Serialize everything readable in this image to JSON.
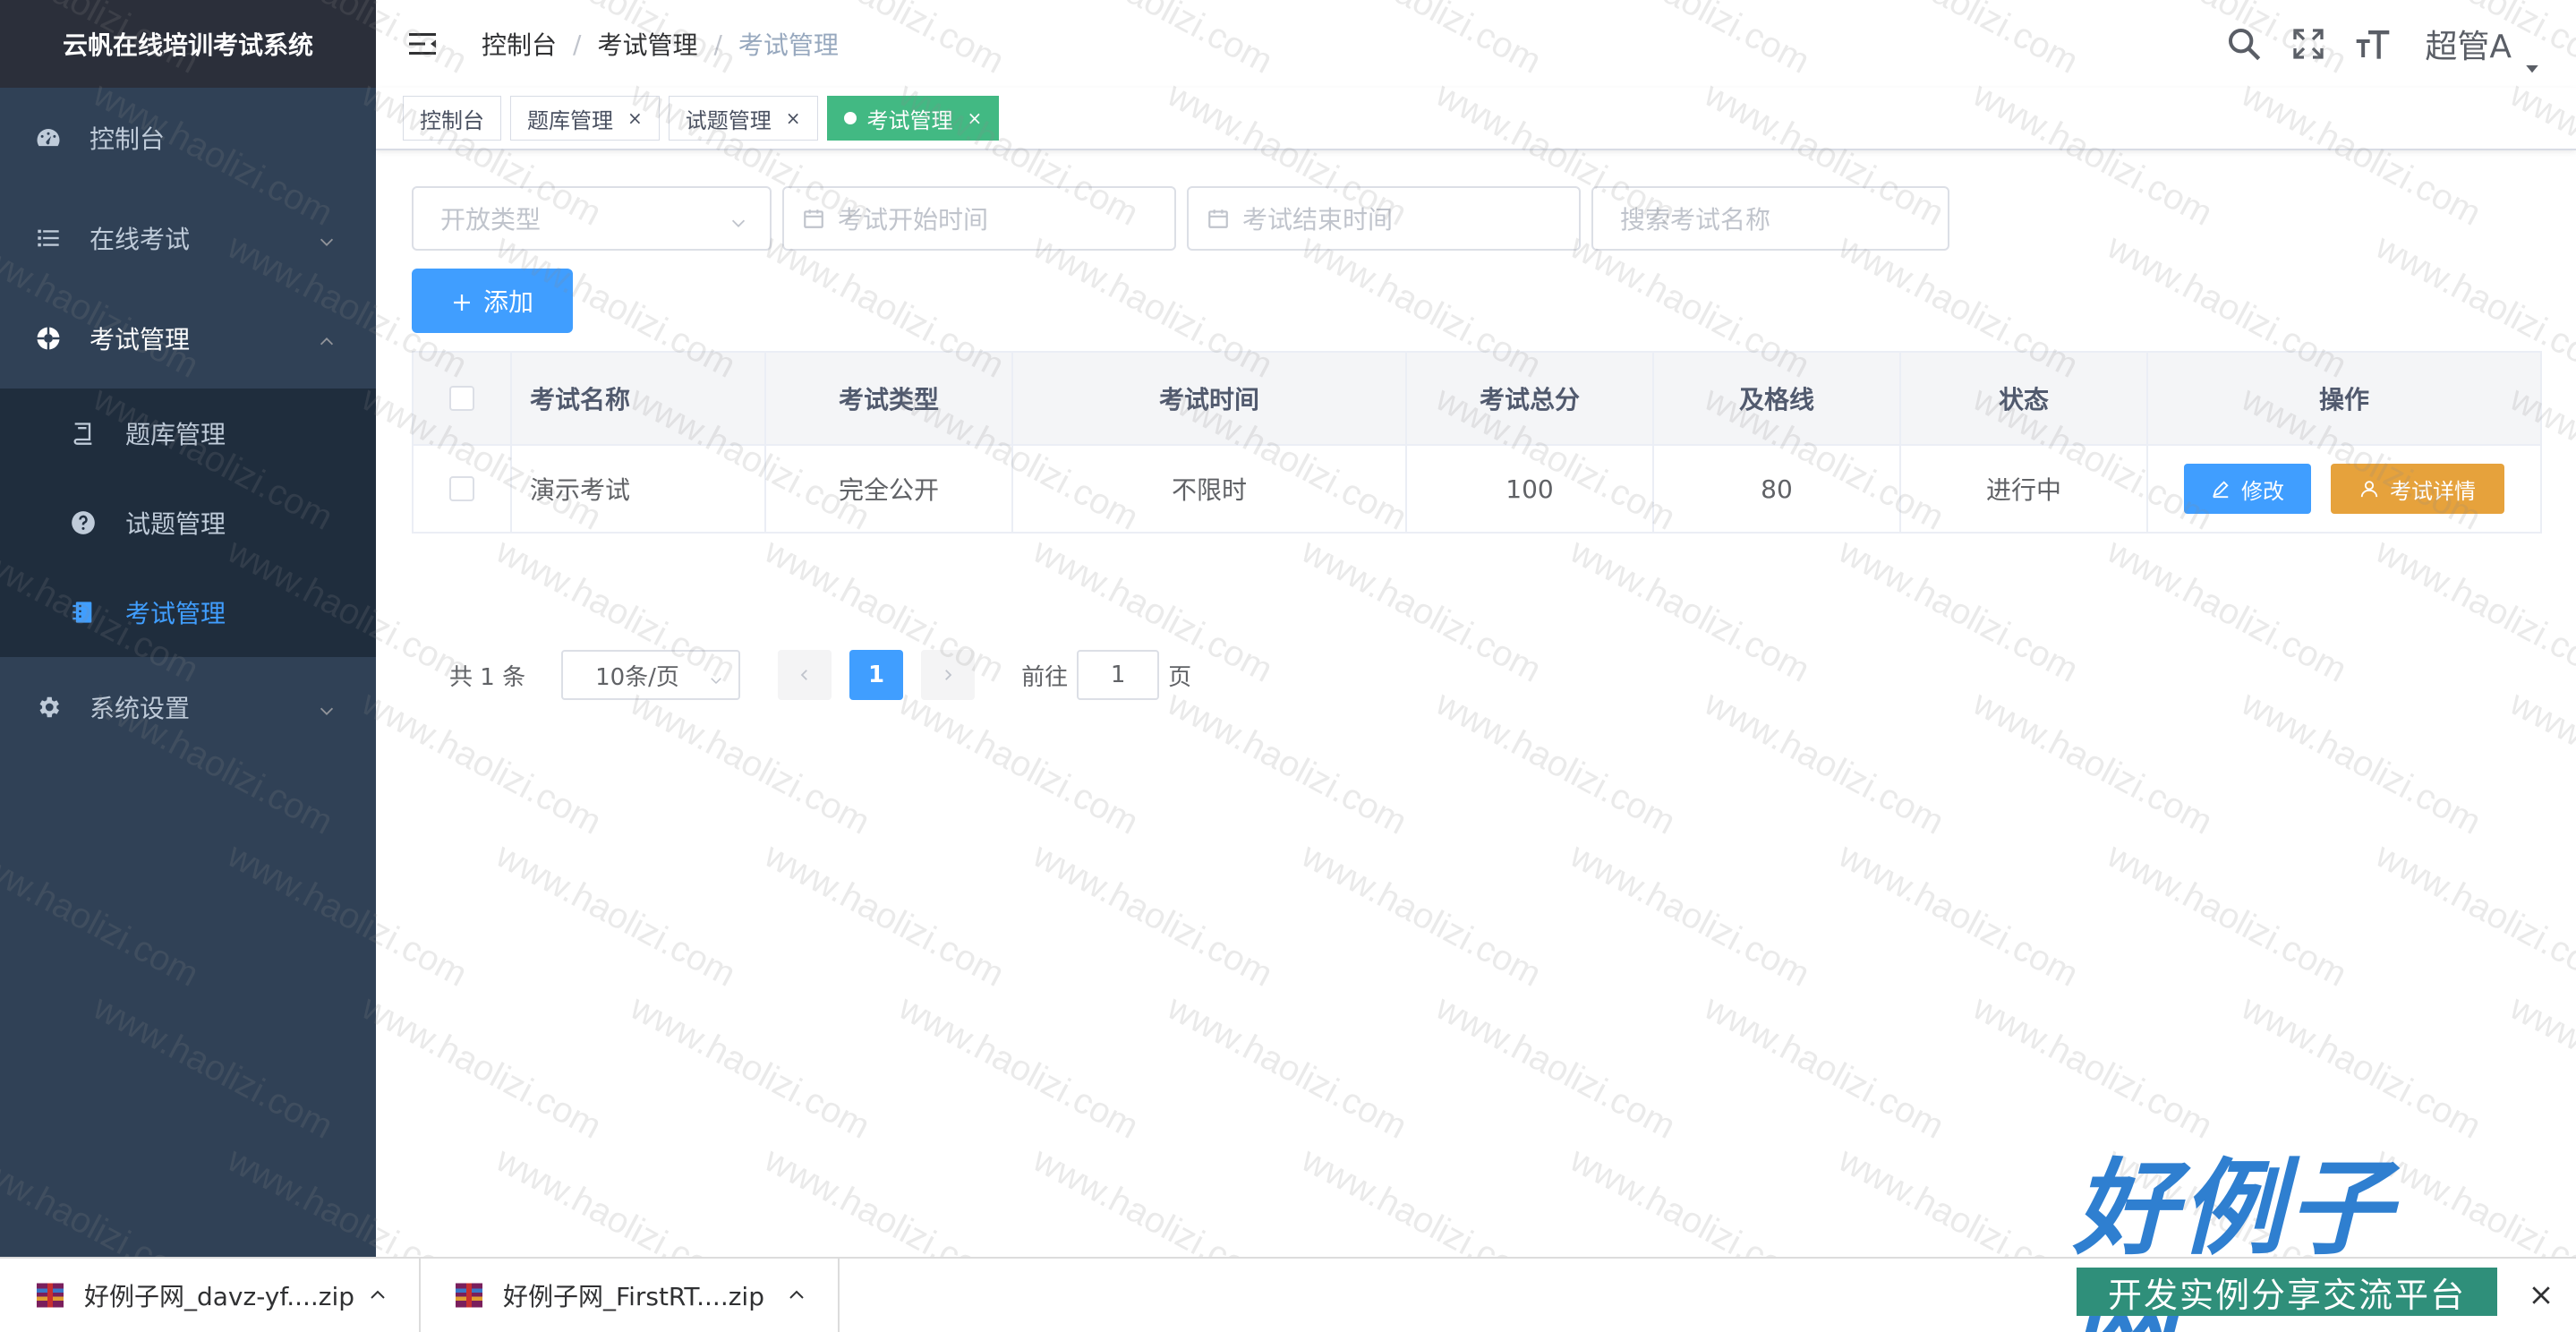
{
  "app": {
    "title": "云帆在线培训考试系统"
  },
  "sidebar": {
    "items": [
      {
        "label": "控制台",
        "icon": "dashboard-icon"
      },
      {
        "label": "在线考试",
        "icon": "list-icon"
      },
      {
        "label": "考试管理",
        "icon": "aperture-icon"
      },
      {
        "label": "系统设置",
        "icon": "gear-icon"
      }
    ],
    "subitems": [
      {
        "label": "题库管理",
        "icon": "book-icon"
      },
      {
        "label": "试题管理",
        "icon": "question-icon"
      },
      {
        "label": "考试管理",
        "icon": "notebook-icon"
      }
    ]
  },
  "header": {
    "breadcrumb": [
      "控制台",
      "考试管理",
      "考试管理"
    ],
    "separator": "/",
    "user": "超管A"
  },
  "tags": [
    {
      "label": "控制台"
    },
    {
      "label": "题库管理",
      "close": "×"
    },
    {
      "label": "试题管理",
      "close": "×"
    },
    {
      "label": "考试管理",
      "close": "×"
    }
  ],
  "filters": {
    "open_type": "开放类型",
    "start_time": "考试开始时间",
    "end_time": "考试结束时间",
    "search": "搜索考试名称"
  },
  "toolbar": {
    "add_label": "添加"
  },
  "table": {
    "columns": [
      "考试名称",
      "考试类型",
      "考试时间",
      "考试总分",
      "及格线",
      "状态",
      "操作"
    ],
    "rows": [
      {
        "name": "演示考试",
        "type": "完全公开",
        "time": "不限时",
        "total": "100",
        "pass": "80",
        "status": "进行中"
      }
    ],
    "actions": {
      "edit": "修改",
      "detail": "考试详情"
    }
  },
  "pagination": {
    "total_text": "共 1 条",
    "page_size": "10条/页",
    "current": "1",
    "goto_label": "前往",
    "goto_value": "1",
    "page_suffix": "页"
  },
  "watermark": "www.haolizi.com",
  "downloads": [
    {
      "name": "好例子网_davz-yf....zip"
    },
    {
      "name": "好例子网_FirstRT....zip"
    }
  ],
  "brand": {
    "title": "好例子网",
    "subtitle": "开发实例分享交流平台"
  },
  "colors": {
    "primary": "#409eff",
    "sidebar": "#304156",
    "tag_active": "#42b983",
    "warning": "#e6a23c"
  }
}
